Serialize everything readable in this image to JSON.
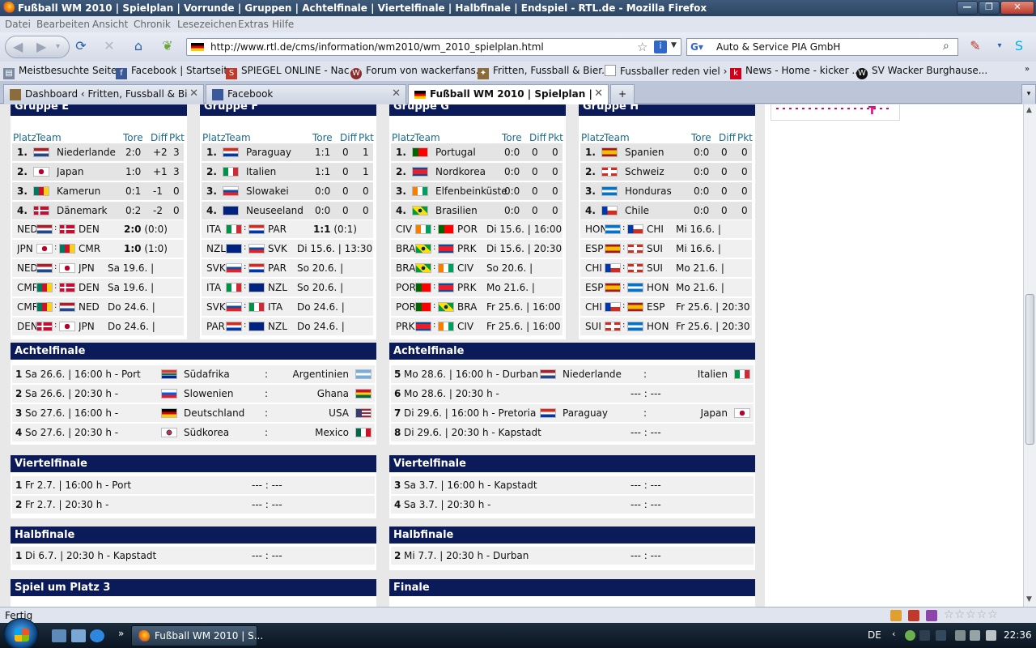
{
  "window": {
    "title": "Fußball WM 2010 | Spielplan | Vorrunde | Gruppen | Achtelfinale | Viertelfinale | Halbfinale | Endspiel - RTL.de - Mozilla Firefox",
    "minimize": "—",
    "maximize": "❐",
    "close": "✕"
  },
  "menu": [
    "Datei",
    "Bearbeiten",
    "Ansicht",
    "Chronik",
    "Lesezeichen",
    "Extras",
    "Hilfe"
  ],
  "nav": {
    "back_icon": "back-arrow-icon",
    "url": "http://www.rtl.de/cms/information/wm2010/wm_2010_spielplan.html",
    "search_text": "Auto & Service PIA GmbH",
    "search_engine_icon": "google-icon"
  },
  "bookmarks": [
    {
      "label": "Meistbesuchte Seiten",
      "color": "#7a8aa0"
    },
    {
      "label": "Facebook | Startseite",
      "color": "#3b5998"
    },
    {
      "label": "SPIEGEL ONLINE - Nac...",
      "color": "#c0392b"
    },
    {
      "label": "Forum von wackerfans...",
      "color": "#8b2b2b"
    },
    {
      "label": "Fritten, Fussball & Bier...",
      "color": "#8a6d3b"
    },
    {
      "label": "Fussballer reden viel › ...",
      "color": "#e0e0e0"
    },
    {
      "label": "News - Home - kicker ...",
      "color": "#d0021b"
    },
    {
      "label": "SV Wacker Burghause...",
      "color": "#111111"
    }
  ],
  "tabs": [
    {
      "label": "Dashboard ‹ Fritten, Fussball & Bier ...",
      "active": false
    },
    {
      "label": "Facebook",
      "active": false
    },
    {
      "label": "Fußball WM 2010 | Spielplan | Vor...",
      "active": true
    }
  ],
  "new_tab": "+",
  "table_headers": {
    "platz": "Platz",
    "team": "Team",
    "tore": "Tore",
    "diff": "Diff",
    "pkt": "Pkt"
  },
  "groups": [
    {
      "name": "Gruppe E",
      "table": [
        {
          "pos": "1.",
          "team": "Niederlande",
          "tore": "2:0",
          "diff": "+2",
          "pkt": "3",
          "flag": "NED"
        },
        {
          "pos": "2.",
          "team": "Japan",
          "tore": "1:0",
          "diff": "+1",
          "pkt": "3",
          "flag": "JPN"
        },
        {
          "pos": "3.",
          "team": "Kamerun",
          "tore": "0:1",
          "diff": "-1",
          "pkt": "0",
          "flag": "CMR"
        },
        {
          "pos": "4.",
          "team": "Dänemark",
          "tore": "0:2",
          "diff": "-2",
          "pkt": "0",
          "flag": "DEN"
        }
      ],
      "matches": [
        {
          "home": "NED",
          "away": "DEN",
          "result": "2:0",
          "extra": " (0:0)",
          "bold": true
        },
        {
          "home": "JPN",
          "away": "CMR",
          "result": "1:0",
          "extra": " (1:0)",
          "bold": true
        },
        {
          "home": "NED",
          "away": "JPN",
          "result": "Sa 19.6. |",
          "extra": "",
          "bold": false
        },
        {
          "home": "CMR",
          "away": "DEN",
          "result": "Sa 19.6. |",
          "extra": "",
          "bold": false
        },
        {
          "home": "CMR",
          "away": "NED",
          "result": "Do 24.6. |",
          "extra": "",
          "bold": false
        },
        {
          "home": "DEN",
          "away": "JPN",
          "result": "Do 24.6. |",
          "extra": "",
          "bold": false
        }
      ]
    },
    {
      "name": "Gruppe F",
      "table": [
        {
          "pos": "1.",
          "team": "Paraguay",
          "tore": "1:1",
          "diff": "0",
          "pkt": "1",
          "flag": "PAR"
        },
        {
          "pos": "2.",
          "team": "Italien",
          "tore": "1:1",
          "diff": "0",
          "pkt": "1",
          "flag": "ITA"
        },
        {
          "pos": "3.",
          "team": "Slowakei",
          "tore": "0:0",
          "diff": "0",
          "pkt": "0",
          "flag": "SVK"
        },
        {
          "pos": "4.",
          "team": "Neuseeland",
          "tore": "0:0",
          "diff": "0",
          "pkt": "0",
          "flag": "NZL"
        }
      ],
      "matches": [
        {
          "home": "ITA",
          "away": "PAR",
          "result": "1:1",
          "extra": " (0:1)",
          "bold": true
        },
        {
          "home": "NZL",
          "away": "SVK",
          "result": "Di 15.6. | 13:30",
          "extra": "",
          "bold": false
        },
        {
          "home": "SVK",
          "away": "PAR",
          "result": "So 20.6. |",
          "extra": "",
          "bold": false
        },
        {
          "home": "ITA",
          "away": "NZL",
          "result": "So 20.6. |",
          "extra": "",
          "bold": false
        },
        {
          "home": "SVK",
          "away": "ITA",
          "result": "Do 24.6. |",
          "extra": "",
          "bold": false
        },
        {
          "home": "PAR",
          "away": "NZL",
          "result": "Do 24.6. |",
          "extra": "",
          "bold": false
        }
      ]
    },
    {
      "name": "Gruppe G",
      "table": [
        {
          "pos": "1.",
          "team": "Portugal",
          "tore": "0:0",
          "diff": "0",
          "pkt": "0",
          "flag": "POR"
        },
        {
          "pos": "2.",
          "team": "Nordkorea",
          "tore": "0:0",
          "diff": "0",
          "pkt": "0",
          "flag": "PRK"
        },
        {
          "pos": "3.",
          "team": "Elfenbeinküste",
          "tore": "0:0",
          "diff": "0",
          "pkt": "0",
          "flag": "CIV"
        },
        {
          "pos": "4.",
          "team": "Brasilien",
          "tore": "0:0",
          "diff": "0",
          "pkt": "0",
          "flag": "BRA"
        }
      ],
      "matches": [
        {
          "home": "CIV",
          "away": "POR",
          "result": "Di 15.6. | 16:00",
          "extra": "",
          "bold": false
        },
        {
          "home": "BRA",
          "away": "PRK",
          "result": "Di 15.6. | 20:30",
          "extra": "",
          "bold": false
        },
        {
          "home": "BRA",
          "away": "CIV",
          "result": "So 20.6. |",
          "extra": "",
          "bold": false
        },
        {
          "home": "POR",
          "away": "PRK",
          "result": "Mo 21.6. |",
          "extra": "",
          "bold": false
        },
        {
          "home": "POR",
          "away": "BRA",
          "result": "Fr 25.6. | 16:00",
          "extra": "",
          "bold": false
        },
        {
          "home": "PRK",
          "away": "CIV",
          "result": "Fr 25.6. | 16:00",
          "extra": "",
          "bold": false
        }
      ]
    },
    {
      "name": "Gruppe H",
      "table": [
        {
          "pos": "1.",
          "team": "Spanien",
          "tore": "0:0",
          "diff": "0",
          "pkt": "0",
          "flag": "ESP"
        },
        {
          "pos": "2.",
          "team": "Schweiz",
          "tore": "0:0",
          "diff": "0",
          "pkt": "0",
          "flag": "SUI"
        },
        {
          "pos": "3.",
          "team": "Honduras",
          "tore": "0:0",
          "diff": "0",
          "pkt": "0",
          "flag": "HON"
        },
        {
          "pos": "4.",
          "team": "Chile",
          "tore": "0:0",
          "diff": "0",
          "pkt": "0",
          "flag": "CHI"
        }
      ],
      "matches": [
        {
          "home": "HON",
          "away": "CHI",
          "result": "Mi 16.6. |",
          "extra": "",
          "bold": false
        },
        {
          "home": "ESP",
          "away": "SUI",
          "result": "Mi 16.6. |",
          "extra": "",
          "bold": false
        },
        {
          "home": "CHI",
          "away": "SUI",
          "result": "Mo 21.6. |",
          "extra": "",
          "bold": false
        },
        {
          "home": "ESP",
          "away": "HON",
          "result": "Mo 21.6. |",
          "extra": "",
          "bold": false
        },
        {
          "home": "CHI",
          "away": "ESP",
          "result": "Fr 25.6. | 20:30",
          "extra": "",
          "bold": false
        },
        {
          "home": "SUI",
          "away": "HON",
          "result": "Fr 25.6. | 20:30",
          "extra": "",
          "bold": false
        }
      ]
    }
  ],
  "knockout": {
    "achtel_left": {
      "title": "Achtelfinale",
      "rows": [
        {
          "no": "1",
          "when": "Sa 26.6. | 16:00 h - Port",
          "home": "Südafrika",
          "home_flag": "RSA",
          "sep": ":",
          "away": "Argentinien",
          "away_flag": "ARG"
        },
        {
          "no": "2",
          "when": "Sa 26.6. | 20:30 h -",
          "home": "Slowenien",
          "home_flag": "SVN",
          "sep": ":",
          "away": "Ghana",
          "away_flag": "GHA"
        },
        {
          "no": "3",
          "when": "So 27.6. | 16:00 h -",
          "home": "Deutschland",
          "home_flag": "GER",
          "sep": ":",
          "away": "USA",
          "away_flag": "USA"
        },
        {
          "no": "4",
          "when": "So 27.6. | 20:30 h -",
          "home": "Südkorea",
          "home_flag": "KOR",
          "sep": ":",
          "away": "Mexico",
          "away_flag": "MEX"
        }
      ]
    },
    "achtel_right": {
      "title": "Achtelfinale",
      "rows": [
        {
          "no": "5",
          "when": "Mo 28.6. | 16:00 h - Durban",
          "home": "Niederlande",
          "home_flag": "NED",
          "sep": ":",
          "away": "Italien",
          "away_flag": "ITA"
        },
        {
          "no": "6",
          "when": "Mo 28.6. | 20:30 h -",
          "home": "",
          "home_flag": "",
          "sep": "--- : ---",
          "away": "",
          "away_flag": ""
        },
        {
          "no": "7",
          "when": "Di 29.6. | 16:00 h - Pretoria",
          "home": "Paraguay",
          "home_flag": "PAR",
          "sep": ":",
          "away": "Japan",
          "away_flag": "JPN"
        },
        {
          "no": "8",
          "when": "Di 29.6. | 20:30 h - Kapstadt",
          "home": "",
          "home_flag": "",
          "sep": "--- : ---",
          "away": "",
          "away_flag": ""
        }
      ]
    },
    "viertel_left": {
      "title": "Viertelfinale",
      "rows": [
        {
          "no": "1",
          "when": "Fr 2.7. | 16:00 h - Port",
          "sep": "--- : ---"
        },
        {
          "no": "2",
          "when": "Fr 2.7. | 20:30 h -",
          "sep": "--- : ---"
        }
      ]
    },
    "viertel_right": {
      "title": "Viertelfinale",
      "rows": [
        {
          "no": "3",
          "when": "Sa 3.7. | 16:00 h - Kapstadt",
          "sep": "--- : ---"
        },
        {
          "no": "4",
          "when": "Sa 3.7. | 20:30 h -",
          "sep": "--- : ---"
        }
      ]
    },
    "halb_left": {
      "title": "Halbfinale",
      "rows": [
        {
          "no": "1",
          "when": "Di 6.7. | 20:30 h - Kapstadt",
          "sep": "--- : ---"
        }
      ]
    },
    "halb_right": {
      "title": "Halbfinale",
      "rows": [
        {
          "no": "2",
          "when": "Mi 7.7. | 20:30 h - Durban",
          "sep": "--- : ---"
        }
      ]
    },
    "platz3": {
      "title": "Spiel um Platz 3"
    },
    "finale": {
      "title": "Finale"
    }
  },
  "ad": {
    "logo": "T"
  },
  "status": {
    "text": "Fertig"
  },
  "taskbar": {
    "item": "Fußball WM 2010 | S...",
    "lang": "DE",
    "clock": "22:36",
    "chevron": "»"
  },
  "colors": {
    "header_navy": "#0b1b5a",
    "table_header_teal": "#1a6a8f",
    "telekom_magenta": "#e20074"
  }
}
